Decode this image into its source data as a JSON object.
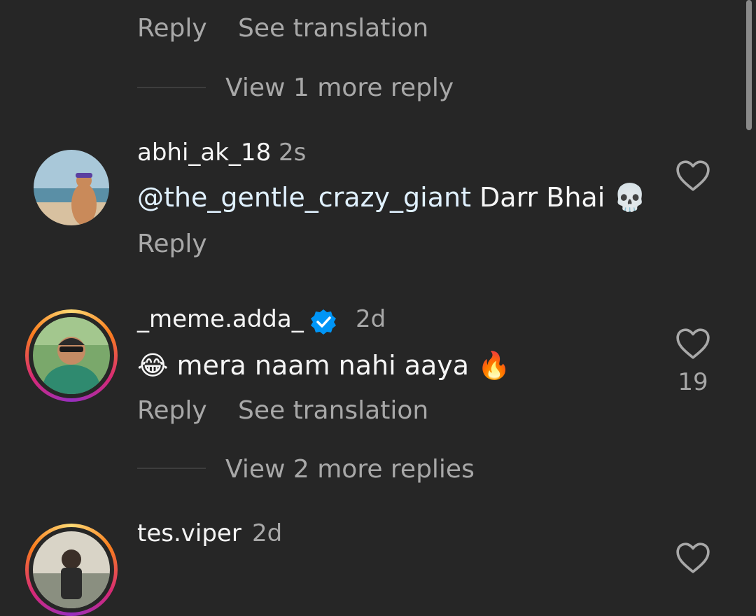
{
  "top_comment": {
    "reply_label": "Reply",
    "see_translation_label": "See translation",
    "view_more_label": "View 1 more reply"
  },
  "comments": [
    {
      "username": "abhi_ak_18",
      "time": "2s",
      "mention": "@the_gentle_crazy_giant",
      "text": " Darr Bhai 💀",
      "reply_label": "Reply"
    },
    {
      "username": "_meme.adda_",
      "time": "2d",
      "verified": true,
      "text": "😂 mera naam nahi aaya 🔥",
      "like_count": "19",
      "reply_label": "Reply",
      "see_translation_label": "See translation",
      "view_more_label": "View 2 more replies"
    },
    {
      "username": "tes.viper",
      "time": "2d"
    }
  ],
  "colors": {
    "background": "#262626",
    "primary_text": "#f5f5f5",
    "secondary_text": "#a8a8a8",
    "mention": "#e0f1ff",
    "verified": "#0095f6"
  }
}
